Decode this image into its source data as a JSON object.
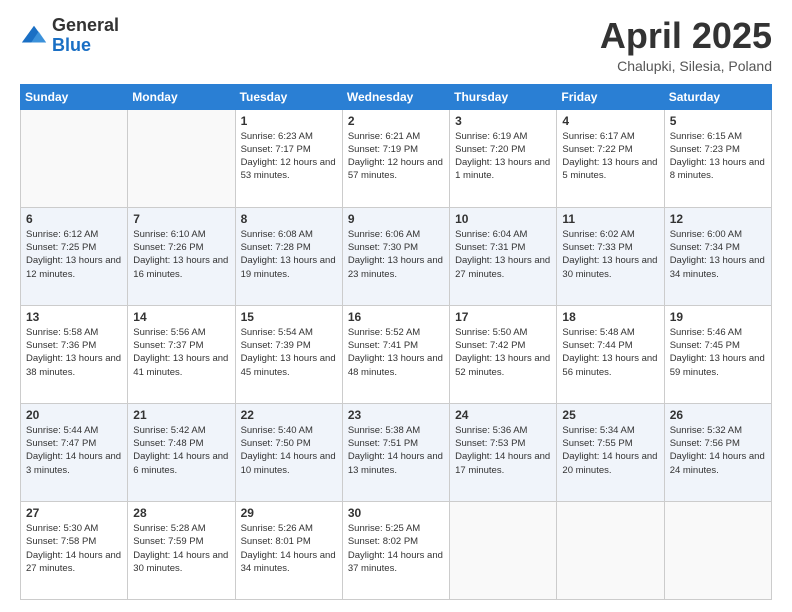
{
  "logo": {
    "general": "General",
    "blue": "Blue"
  },
  "header": {
    "month_year": "April 2025",
    "location": "Chalupki, Silesia, Poland"
  },
  "weekdays": [
    "Sunday",
    "Monday",
    "Tuesday",
    "Wednesday",
    "Thursday",
    "Friday",
    "Saturday"
  ],
  "weeks": [
    [
      {
        "day": "",
        "info": ""
      },
      {
        "day": "",
        "info": ""
      },
      {
        "day": "1",
        "info": "Sunrise: 6:23 AM\nSunset: 7:17 PM\nDaylight: 12 hours and 53 minutes."
      },
      {
        "day": "2",
        "info": "Sunrise: 6:21 AM\nSunset: 7:19 PM\nDaylight: 12 hours and 57 minutes."
      },
      {
        "day": "3",
        "info": "Sunrise: 6:19 AM\nSunset: 7:20 PM\nDaylight: 13 hours and 1 minute."
      },
      {
        "day": "4",
        "info": "Sunrise: 6:17 AM\nSunset: 7:22 PM\nDaylight: 13 hours and 5 minutes."
      },
      {
        "day": "5",
        "info": "Sunrise: 6:15 AM\nSunset: 7:23 PM\nDaylight: 13 hours and 8 minutes."
      }
    ],
    [
      {
        "day": "6",
        "info": "Sunrise: 6:12 AM\nSunset: 7:25 PM\nDaylight: 13 hours and 12 minutes."
      },
      {
        "day": "7",
        "info": "Sunrise: 6:10 AM\nSunset: 7:26 PM\nDaylight: 13 hours and 16 minutes."
      },
      {
        "day": "8",
        "info": "Sunrise: 6:08 AM\nSunset: 7:28 PM\nDaylight: 13 hours and 19 minutes."
      },
      {
        "day": "9",
        "info": "Sunrise: 6:06 AM\nSunset: 7:30 PM\nDaylight: 13 hours and 23 minutes."
      },
      {
        "day": "10",
        "info": "Sunrise: 6:04 AM\nSunset: 7:31 PM\nDaylight: 13 hours and 27 minutes."
      },
      {
        "day": "11",
        "info": "Sunrise: 6:02 AM\nSunset: 7:33 PM\nDaylight: 13 hours and 30 minutes."
      },
      {
        "day": "12",
        "info": "Sunrise: 6:00 AM\nSunset: 7:34 PM\nDaylight: 13 hours and 34 minutes."
      }
    ],
    [
      {
        "day": "13",
        "info": "Sunrise: 5:58 AM\nSunset: 7:36 PM\nDaylight: 13 hours and 38 minutes."
      },
      {
        "day": "14",
        "info": "Sunrise: 5:56 AM\nSunset: 7:37 PM\nDaylight: 13 hours and 41 minutes."
      },
      {
        "day": "15",
        "info": "Sunrise: 5:54 AM\nSunset: 7:39 PM\nDaylight: 13 hours and 45 minutes."
      },
      {
        "day": "16",
        "info": "Sunrise: 5:52 AM\nSunset: 7:41 PM\nDaylight: 13 hours and 48 minutes."
      },
      {
        "day": "17",
        "info": "Sunrise: 5:50 AM\nSunset: 7:42 PM\nDaylight: 13 hours and 52 minutes."
      },
      {
        "day": "18",
        "info": "Sunrise: 5:48 AM\nSunset: 7:44 PM\nDaylight: 13 hours and 56 minutes."
      },
      {
        "day": "19",
        "info": "Sunrise: 5:46 AM\nSunset: 7:45 PM\nDaylight: 13 hours and 59 minutes."
      }
    ],
    [
      {
        "day": "20",
        "info": "Sunrise: 5:44 AM\nSunset: 7:47 PM\nDaylight: 14 hours and 3 minutes."
      },
      {
        "day": "21",
        "info": "Sunrise: 5:42 AM\nSunset: 7:48 PM\nDaylight: 14 hours and 6 minutes."
      },
      {
        "day": "22",
        "info": "Sunrise: 5:40 AM\nSunset: 7:50 PM\nDaylight: 14 hours and 10 minutes."
      },
      {
        "day": "23",
        "info": "Sunrise: 5:38 AM\nSunset: 7:51 PM\nDaylight: 14 hours and 13 minutes."
      },
      {
        "day": "24",
        "info": "Sunrise: 5:36 AM\nSunset: 7:53 PM\nDaylight: 14 hours and 17 minutes."
      },
      {
        "day": "25",
        "info": "Sunrise: 5:34 AM\nSunset: 7:55 PM\nDaylight: 14 hours and 20 minutes."
      },
      {
        "day": "26",
        "info": "Sunrise: 5:32 AM\nSunset: 7:56 PM\nDaylight: 14 hours and 24 minutes."
      }
    ],
    [
      {
        "day": "27",
        "info": "Sunrise: 5:30 AM\nSunset: 7:58 PM\nDaylight: 14 hours and 27 minutes."
      },
      {
        "day": "28",
        "info": "Sunrise: 5:28 AM\nSunset: 7:59 PM\nDaylight: 14 hours and 30 minutes."
      },
      {
        "day": "29",
        "info": "Sunrise: 5:26 AM\nSunset: 8:01 PM\nDaylight: 14 hours and 34 minutes."
      },
      {
        "day": "30",
        "info": "Sunrise: 5:25 AM\nSunset: 8:02 PM\nDaylight: 14 hours and 37 minutes."
      },
      {
        "day": "",
        "info": ""
      },
      {
        "day": "",
        "info": ""
      },
      {
        "day": "",
        "info": ""
      }
    ]
  ]
}
